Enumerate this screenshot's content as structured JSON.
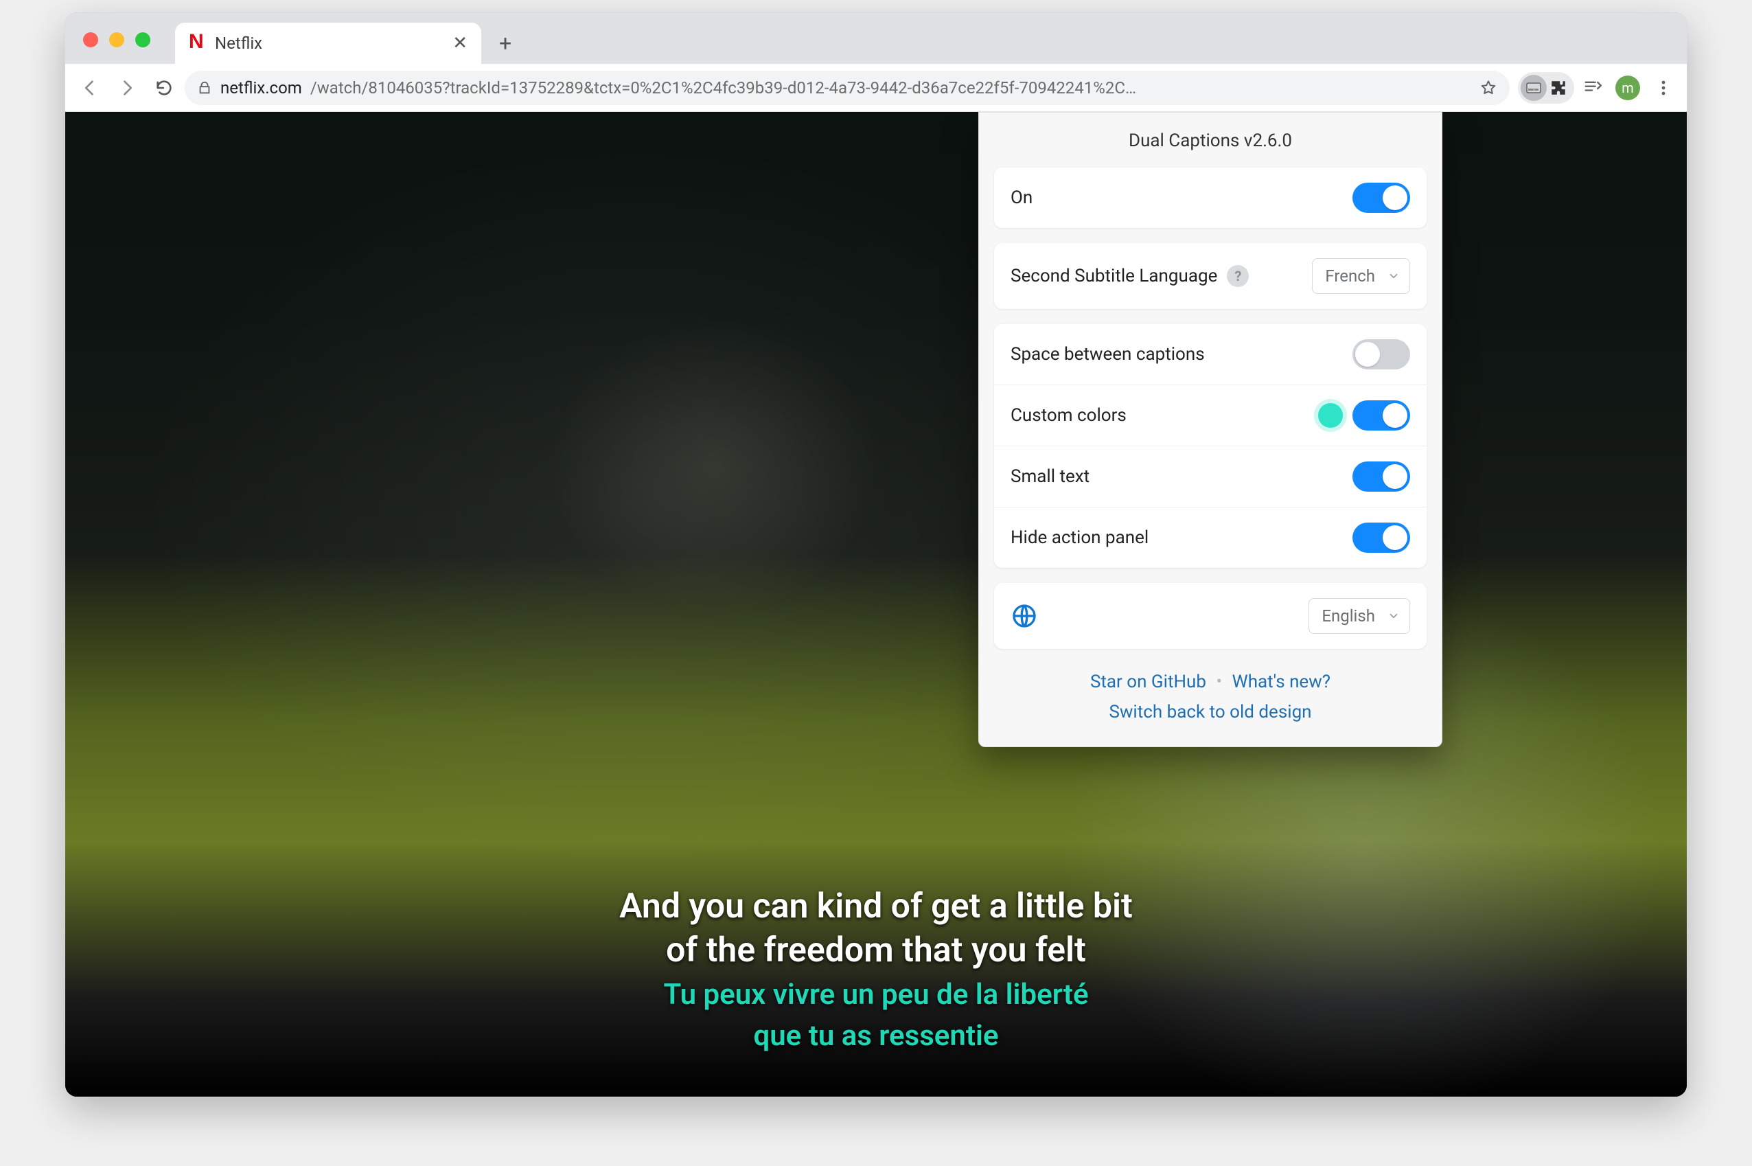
{
  "browser": {
    "tab_title": "Netflix",
    "url_host": "netflix.com",
    "url_path": "/watch/81046035?trackId=13752289&tctx=0%2C1%2C4fc39b39-d012-4a73-9442-d36a7ce22f5f-70942241%2C…",
    "avatar_initial": "m"
  },
  "captions": {
    "primary_line1": "And you can kind of get a little bit",
    "primary_line2": "of the freedom that you felt",
    "secondary_line1": "Tu peux vivre un peu de la liberté",
    "secondary_line2": "que tu as ressentie",
    "secondary_color": "#1fd8b6"
  },
  "popup": {
    "title": "Dual Captions v2.6.0",
    "on_label": "On",
    "on_state": true,
    "second_lang_label": "Second Subtitle Language",
    "second_lang_value": "French",
    "rows": {
      "space_label": "Space between captions",
      "space_state": false,
      "colors_label": "Custom colors",
      "colors_state": true,
      "colors_swatch": "#2fe3c6",
      "small_label": "Small text",
      "small_state": true,
      "hide_label": "Hide action panel",
      "hide_state": true
    },
    "ui_lang_value": "English",
    "links": {
      "github": "Star on GitHub",
      "whatsnew": "What's new?",
      "switch": "Switch back to old design"
    }
  }
}
